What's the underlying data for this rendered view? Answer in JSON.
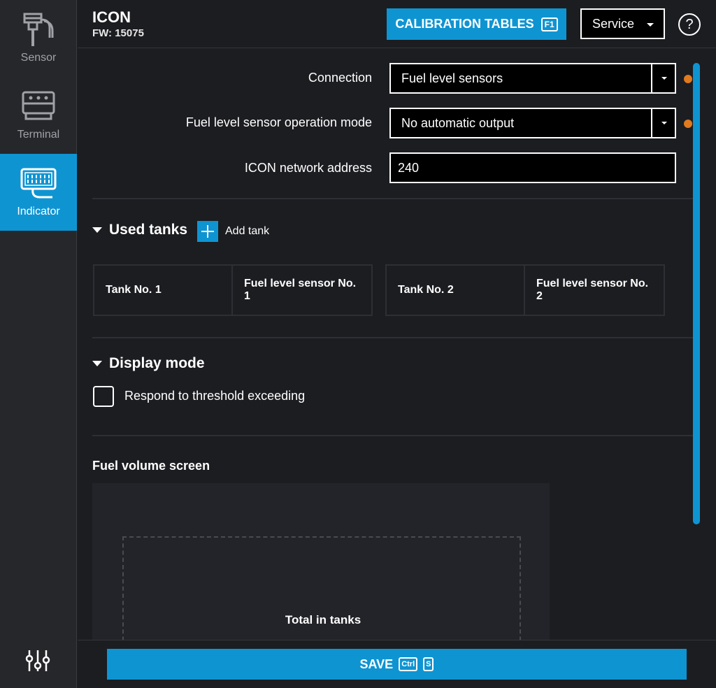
{
  "sidebar": {
    "items": [
      {
        "label": "Sensor",
        "icon": "sensor-icon"
      },
      {
        "label": "Terminal",
        "icon": "terminal-icon"
      },
      {
        "label": "Indicator",
        "icon": "indicator-icon",
        "active": true
      }
    ],
    "settings_icon": "sliders-icon"
  },
  "header": {
    "device_name": "ICON",
    "firmware": "FW: 15075",
    "calibration_button": "CALIBRATION TABLES",
    "calibration_key": "F1",
    "service_select": "Service",
    "help_icon": "?"
  },
  "form": {
    "connection_label": "Connection",
    "connection_value": "Fuel level sensors",
    "mode_label": "Fuel level sensor operation mode",
    "mode_value": "No automatic output",
    "address_label": "ICON network address",
    "address_value": "240"
  },
  "used_tanks": {
    "title": "Used tanks",
    "add_label": "Add tank",
    "tanks": [
      {
        "tank": "Tank No. 1",
        "sensor": "Fuel level sensor No. 1"
      },
      {
        "tank": "Tank No. 2",
        "sensor": "Fuel level sensor No. 2"
      }
    ]
  },
  "display_mode": {
    "title": "Display mode",
    "threshold_label": "Respond to threshold exceeding",
    "threshold_checked": false
  },
  "fuel_volume_screen": {
    "title": "Fuel volume screen",
    "caption": "Total in tanks"
  },
  "footer": {
    "save_label": "SAVE",
    "save_keys": [
      "Ctrl",
      "S"
    ]
  },
  "colors": {
    "accent": "#0f94d2",
    "modified_dot": "#e07a1f",
    "background": "#1c1d21",
    "sidebar": "#26272b"
  }
}
